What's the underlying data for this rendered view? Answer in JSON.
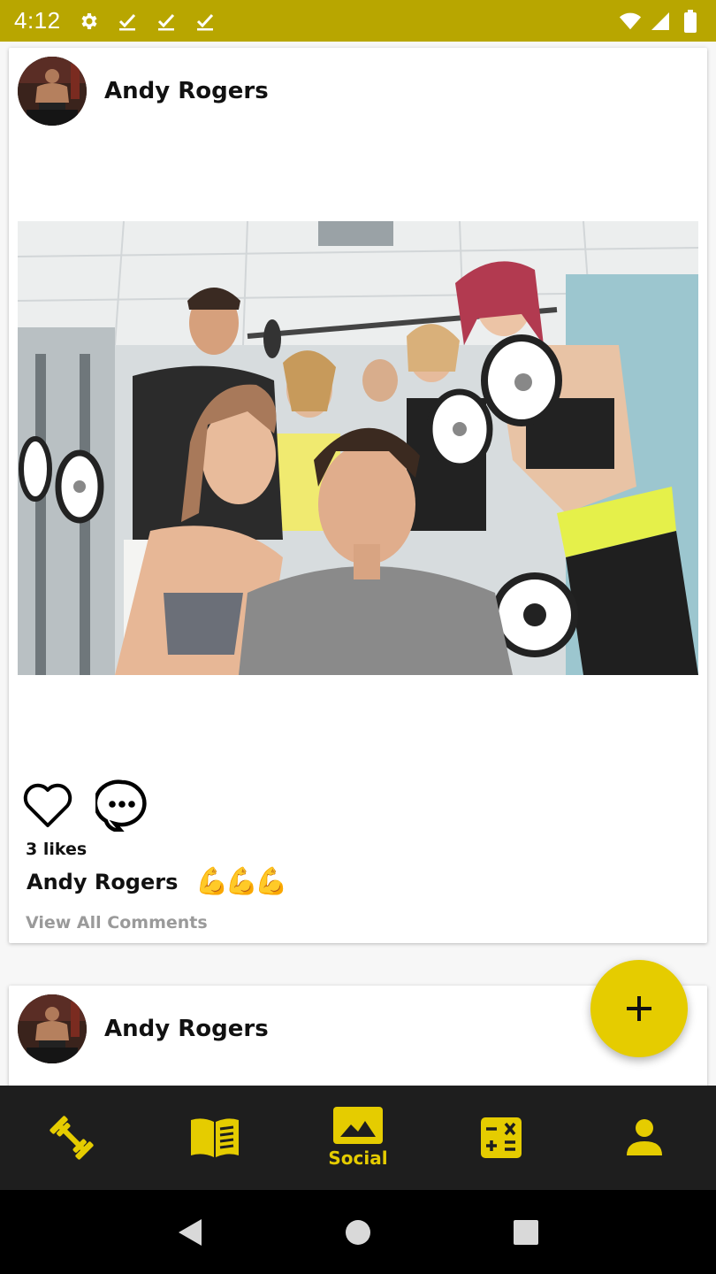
{
  "status_bar": {
    "time": "4:12",
    "left_icons": [
      "settings-icon",
      "download-done-icon",
      "download-done-icon",
      "download-done-icon"
    ],
    "right_icons": [
      "wifi-icon",
      "signal-icon",
      "battery-icon"
    ],
    "background": "#b8a600"
  },
  "posts": [
    {
      "author": "Andy Rogers",
      "likes": "3 likes",
      "caption_author": "Andy Rogers",
      "caption_text": "💪💪💪",
      "view_comments": "View All Comments"
    },
    {
      "author": "Andy Rogers"
    }
  ],
  "bottom_nav": {
    "items": [
      {
        "icon": "dumbbell-icon",
        "label": ""
      },
      {
        "icon": "book-icon",
        "label": ""
      },
      {
        "icon": "image-icon",
        "label": "Social"
      },
      {
        "icon": "calculator-icon",
        "label": ""
      },
      {
        "icon": "person-icon",
        "label": ""
      }
    ],
    "active": "Social",
    "accent": "#e5cc00",
    "background": "#1e1e1e"
  },
  "fab": {
    "icon": "plus-icon",
    "color": "#e5cc00"
  },
  "system_nav": {
    "icons": [
      "back-icon",
      "home-icon",
      "recents-icon"
    ]
  }
}
